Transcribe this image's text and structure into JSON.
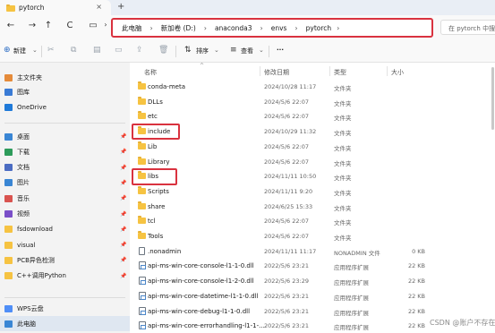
{
  "tab": {
    "title": "pytorch",
    "close": "×",
    "new": "+"
  },
  "nav": {
    "back": "←",
    "forward": "→",
    "up": "↑",
    "refresh": "C",
    "monitor": "▭",
    "more": "›"
  },
  "address": {
    "crumbs": [
      "此电脑",
      "新加卷 (D:)",
      "anaconda3",
      "envs",
      "pytorch"
    ],
    "sep": "›",
    "end": "›"
  },
  "search": {
    "placeholder": "在 pytorch 中搜索"
  },
  "commands": {
    "new": "新建",
    "new_arrow": "⌄",
    "sort": "排序",
    "view": "查看",
    "more": "···"
  },
  "sidebar": {
    "quick": [
      {
        "label": "主文件夹",
        "color": "#e58b3a"
      },
      {
        "label": "图库",
        "color": "#3a7bd5"
      },
      {
        "label": "OneDrive",
        "color": "#1f7ad9"
      }
    ],
    "pinned": [
      {
        "label": "桌面",
        "color": "#3a86d4",
        "pin": "📌"
      },
      {
        "label": "下载",
        "color": "#2d9b5a",
        "pin": "📌"
      },
      {
        "label": "文档",
        "color": "#4b6cc2",
        "pin": "📌"
      },
      {
        "label": "图片",
        "color": "#3a86d4",
        "pin": "📌"
      },
      {
        "label": "音乐",
        "color": "#d9534f",
        "pin": "📌"
      },
      {
        "label": "视频",
        "color": "#7a4fc8",
        "pin": "📌"
      },
      {
        "label": "fsdownload",
        "color": "#f6c342",
        "pin": "📌"
      },
      {
        "label": "visual",
        "color": "#f6c342",
        "pin": "📌"
      },
      {
        "label": "PCB异色检测",
        "color": "#f6c342",
        "pin": "📌"
      },
      {
        "label": "C++调用Python",
        "color": "#f6c342",
        "pin": "📌"
      }
    ],
    "bottom": [
      {
        "label": "WPS云盘",
        "color": "#4f8ef7"
      },
      {
        "label": "此电脑",
        "color": "#3a86d4"
      }
    ]
  },
  "columns": {
    "name": "名称",
    "date": "修改日期",
    "type": "类型",
    "size": "大小",
    "sort_indicator": "^"
  },
  "files": [
    {
      "name": "conda-meta",
      "date": "2024/10/28 11:17",
      "type": "文件夹",
      "size": "",
      "kind": "folder"
    },
    {
      "name": "DLLs",
      "date": "2024/5/6 22:07",
      "type": "文件夹",
      "size": "",
      "kind": "folder"
    },
    {
      "name": "etc",
      "date": "2024/5/6 22:07",
      "type": "文件夹",
      "size": "",
      "kind": "folder"
    },
    {
      "name": "include",
      "date": "2024/10/29 11:32",
      "type": "文件夹",
      "size": "",
      "kind": "folder"
    },
    {
      "name": "Lib",
      "date": "2024/5/6 22:07",
      "type": "文件夹",
      "size": "",
      "kind": "folder"
    },
    {
      "name": "Library",
      "date": "2024/5/6 22:07",
      "type": "文件夹",
      "size": "",
      "kind": "folder"
    },
    {
      "name": "libs",
      "date": "2024/11/11 10:50",
      "type": "文件夹",
      "size": "",
      "kind": "folder"
    },
    {
      "name": "Scripts",
      "date": "2024/11/11 9:20",
      "type": "文件夹",
      "size": "",
      "kind": "folder"
    },
    {
      "name": "share",
      "date": "2024/6/25 15:33",
      "type": "文件夹",
      "size": "",
      "kind": "folder"
    },
    {
      "name": "tcl",
      "date": "2024/5/6 22:07",
      "type": "文件夹",
      "size": "",
      "kind": "folder"
    },
    {
      "name": "Tools",
      "date": "2024/5/6 22:07",
      "type": "文件夹",
      "size": "",
      "kind": "folder"
    },
    {
      "name": ".nonadmin",
      "date": "2024/11/11 11:17",
      "type": "NONADMIN 文件",
      "size": "0 KB",
      "kind": "file"
    },
    {
      "name": "api-ms-win-core-console-l1-1-0.dll",
      "date": "2022/5/6 23:21",
      "type": "应用程序扩展",
      "size": "22 KB",
      "kind": "dll"
    },
    {
      "name": "api-ms-win-core-console-l1-2-0.dll",
      "date": "2022/5/6 23:29",
      "type": "应用程序扩展",
      "size": "22 KB",
      "kind": "dll"
    },
    {
      "name": "api-ms-win-core-datetime-l1-1-0.dll",
      "date": "2022/5/6 23:21",
      "type": "应用程序扩展",
      "size": "22 KB",
      "kind": "dll"
    },
    {
      "name": "api-ms-win-core-debug-l1-1-0.dll",
      "date": "2022/5/6 23:21",
      "type": "应用程序扩展",
      "size": "22 KB",
      "kind": "dll"
    },
    {
      "name": "api-ms-win-core-errorhandling-l1-1-...",
      "date": "2022/5/6 23:21",
      "type": "应用程序扩展",
      "size": "22 KB",
      "kind": "dll"
    }
  ],
  "watermark": "CSDN @账户不存在",
  "colors": {
    "highlight": "#d9323f",
    "selected": "#dfe7f1",
    "folder": "#f6c342"
  }
}
